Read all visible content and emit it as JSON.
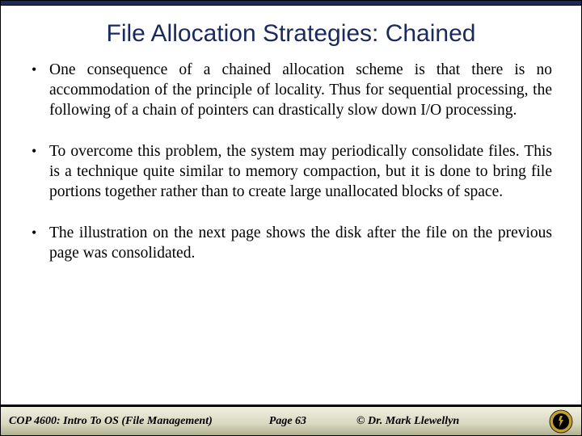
{
  "slide": {
    "title": "File Allocation Strategies: Chained",
    "bullets": [
      "One consequence of a chained allocation scheme is that there is no accommodation of the principle of locality.  Thus for sequential processing, the following of a chain of pointers can drastically slow down I/O processing.",
      "To overcome this problem, the system may periodically consolidate files.  This is a technique quite similar to memory compaction, but it is done to bring file portions together rather than to create large unallocated blocks of space.",
      "The illustration on the next page shows the disk after the file on the previous page was consolidated."
    ]
  },
  "footer": {
    "course": "COP 4600: Intro To OS  (File Management)",
    "page": "Page 63",
    "author": "© Dr. Mark Llewellyn"
  },
  "colors": {
    "accent": "#1a2a5c",
    "logo_gold": "#c5a030"
  }
}
